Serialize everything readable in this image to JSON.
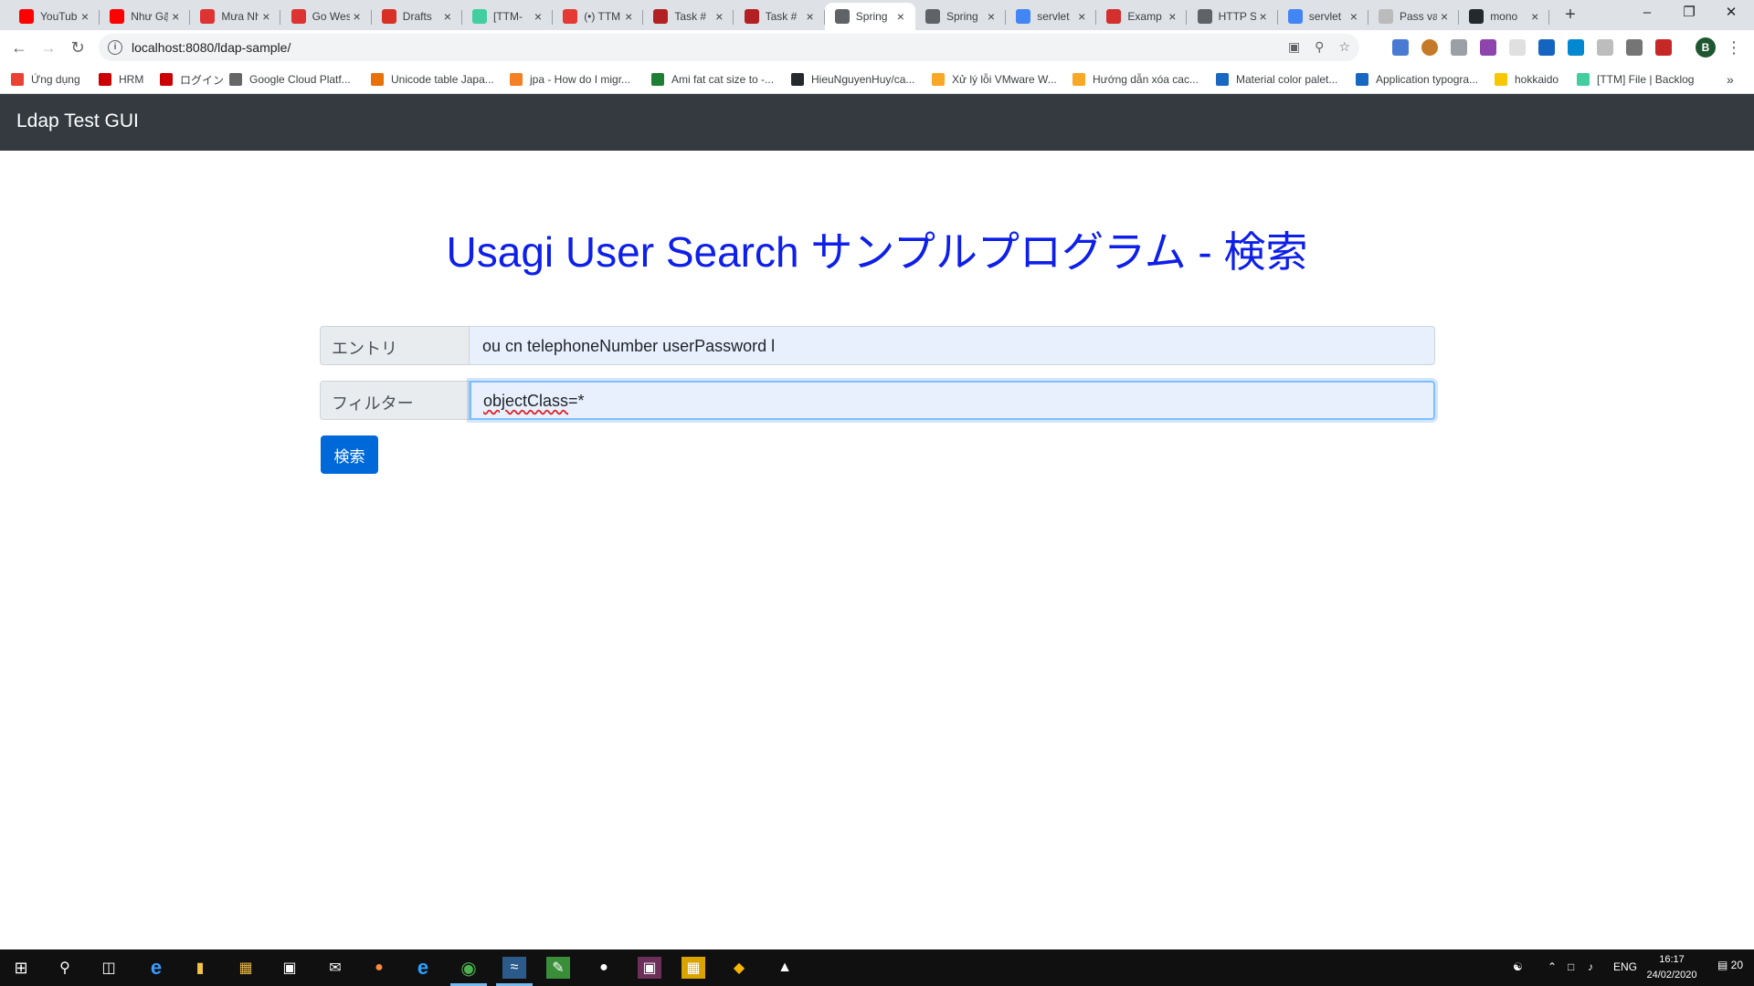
{
  "browser": {
    "tabs": [
      {
        "title": "YouTube",
        "favicon": "youtube-icon",
        "color": "#ff0000"
      },
      {
        "title": "Như Gặp",
        "favicon": "youtube-icon",
        "color": "#ff0000"
      },
      {
        "title": "Mưa Nhỏ",
        "favicon": "youtube-icon",
        "color": "#d33"
      },
      {
        "title": "Go West",
        "favicon": "youtube-icon",
        "color": "#d33"
      },
      {
        "title": "Drafts",
        "favicon": "gmail-icon",
        "color": "#d93025"
      },
      {
        "title": "[TTM-",
        "favicon": "backlog-icon",
        "color": "#42ce9f"
      },
      {
        "title": "(•) TTM",
        "favicon": "chat-icon",
        "color": "#e53935"
      },
      {
        "title": "Task #",
        "favicon": "redmine-icon",
        "color": "#b32024"
      },
      {
        "title": "Task #",
        "favicon": "redmine-icon",
        "color": "#b32024"
      },
      {
        "title": "Spring",
        "favicon": "globe-icon",
        "color": "#5f6368"
      },
      {
        "title": "Spring",
        "favicon": "globe-icon",
        "color": "#5f6368"
      },
      {
        "title": "servlet",
        "favicon": "google-icon",
        "color": "#4285f4"
      },
      {
        "title": "Examp",
        "favicon": "vuetify-icon",
        "color": "#d32f2f"
      },
      {
        "title": "HTTP St",
        "favicon": "globe-icon",
        "color": "#5f6368"
      },
      {
        "title": "servlet",
        "favicon": "google-icon",
        "color": "#4285f4"
      },
      {
        "title": "Pass va",
        "favicon": "blank-icon",
        "color": "#bbbbbb"
      },
      {
        "title": "mono",
        "favicon": "github-icon",
        "color": "#24292e"
      }
    ],
    "active_tab": 9,
    "url": "localhost:8080/ldap-sample/",
    "profile_initial": "B",
    "bookmarks": [
      {
        "label": "Ứng dụng",
        "icon": "apps-icon",
        "color": "#ea4335"
      },
      {
        "label": "HRM",
        "icon": "hrm-icon",
        "color": "#c00"
      },
      {
        "label": "ログイン",
        "icon": "login-icon",
        "color": "#c00"
      },
      {
        "label": "Google Cloud Platf...",
        "icon": "gcp-icon",
        "color": "#666"
      },
      {
        "label": "Unicode table Japa...",
        "icon": "unicode-icon",
        "color": "#e8710a"
      },
      {
        "label": "jpa - How do I migr...",
        "icon": "stackoverflow-icon",
        "color": "#f48024"
      },
      {
        "label": "Ami fat cat size to -...",
        "icon": "ami-icon",
        "color": "#1e7e34"
      },
      {
        "label": "HieuNguyenHuy/ca...",
        "icon": "github-icon",
        "color": "#24292e"
      },
      {
        "label": "Xử lý lỗi VMware W...",
        "icon": "smiley-icon",
        "color": "#f9a825"
      },
      {
        "label": "Hướng dẫn xóa cac...",
        "icon": "smiley-icon",
        "color": "#f9a825"
      },
      {
        "label": "Material color palet...",
        "icon": "vuetify-icon",
        "color": "#1867c0"
      },
      {
        "label": "Application typogra...",
        "icon": "vuetify-icon",
        "color": "#1867c0"
      },
      {
        "label": "hokkaido",
        "icon": "pikachu-icon",
        "color": "#f7c800"
      },
      {
        "label": "[TTM] File | Backlog",
        "icon": "backlog-icon",
        "color": "#42ce9f"
      }
    ]
  },
  "app": {
    "brand": "Ldap Test GUI",
    "heading": "Usagi User Search サンプルプログラム - 検索",
    "entry_label": "エントリ",
    "entry_value": "ou cn telephoneNumber userPassword l",
    "filter_label": "フィルター",
    "filter_value_spell": "objectClass",
    "filter_value_rest": "=*",
    "search_button": "検索"
  },
  "taskbar": {
    "language": "ENG",
    "time": "16:17",
    "date": "24/02/2020",
    "notifications": "20"
  }
}
